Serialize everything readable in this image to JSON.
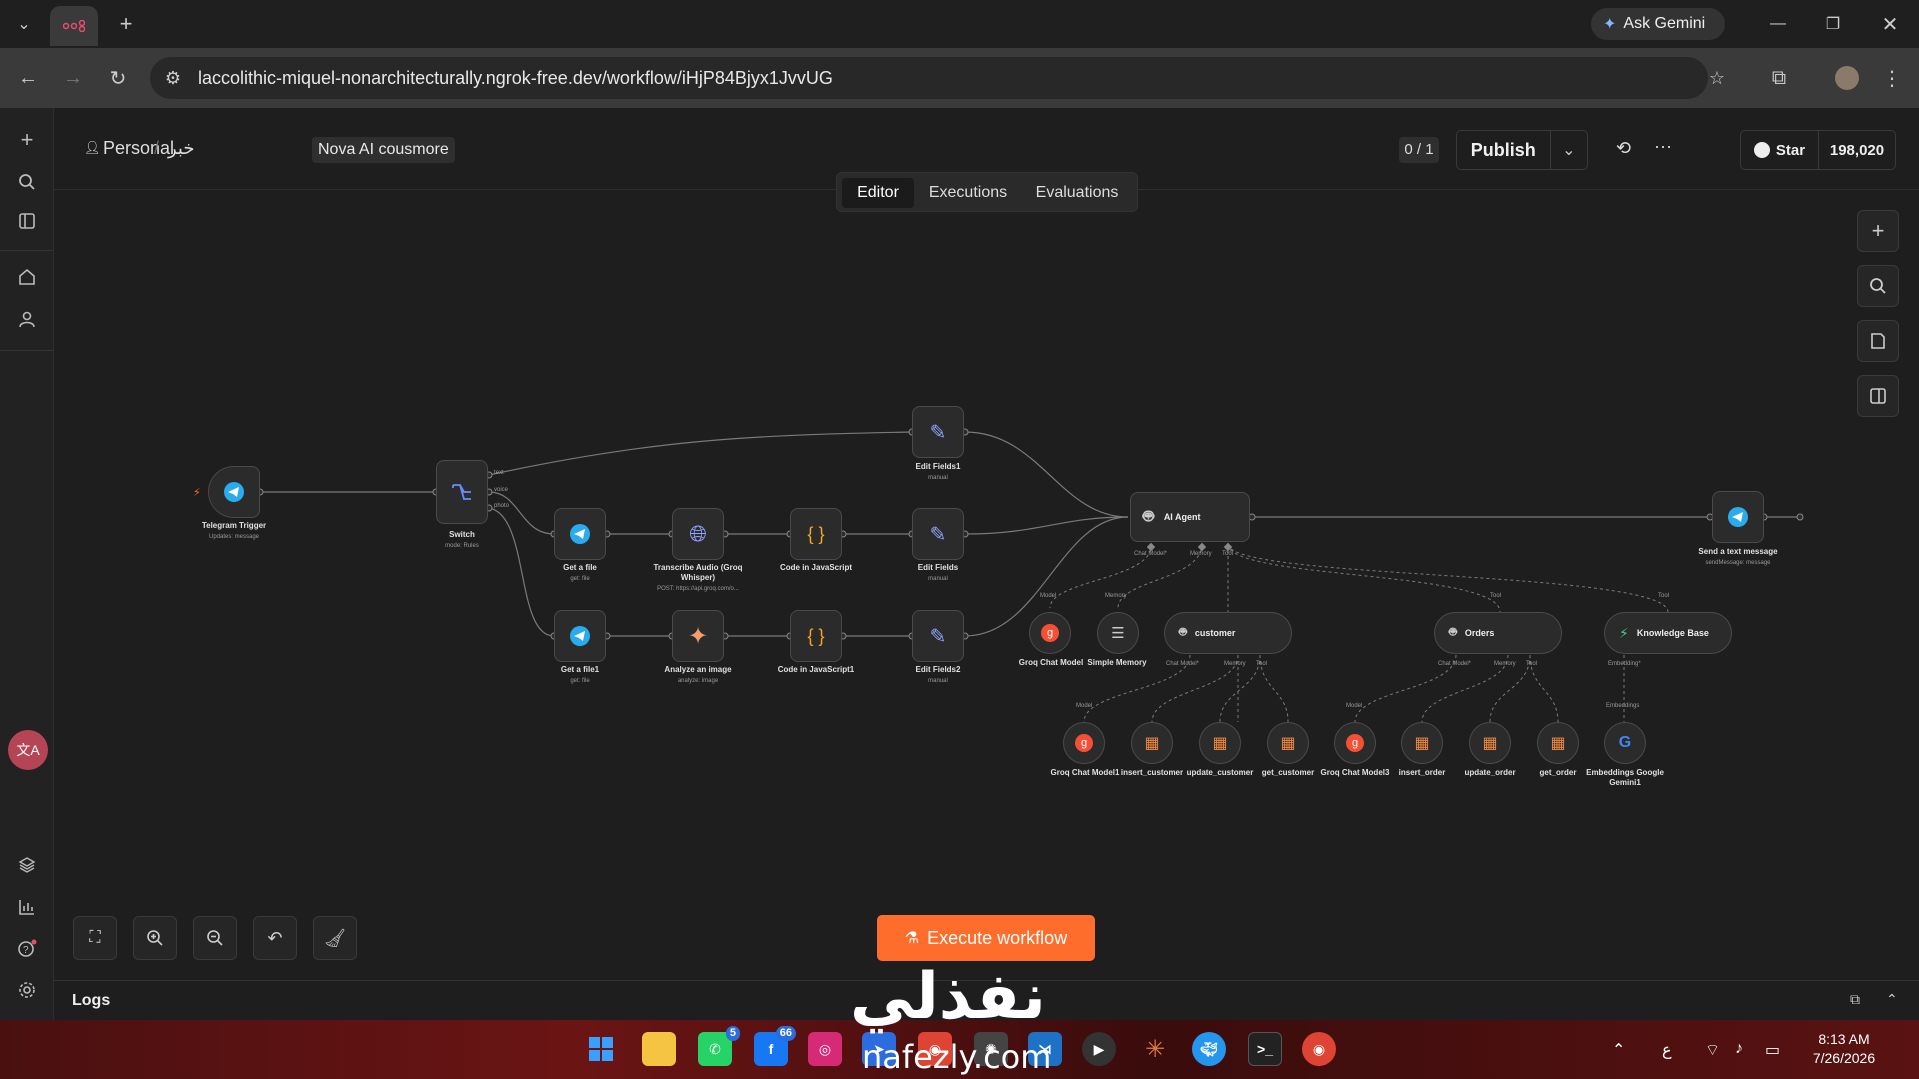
{
  "browser": {
    "url": "laccolithic-miquel-nonarchitecturally.ngrok-free.dev/workflow/iHjP84Bjyx1JvvUG",
    "ask_gemini": "Ask Gemini"
  },
  "header": {
    "project": "Personal",
    "folder": "خبر",
    "workflow_name": "Nova AI cousmore",
    "counter": "0 / 1",
    "publish": "Publish",
    "github_star": "Star",
    "github_count": "198,020"
  },
  "tabs": [
    "Editor",
    "Executions",
    "Evaluations"
  ],
  "nodes": {
    "telegram_trigger": {
      "label": "Telegram Trigger",
      "sub": "Updates: message"
    },
    "switch": {
      "label": "Switch",
      "sub": "mode: Rules",
      "outputs": [
        "text",
        "voice",
        "photo"
      ]
    },
    "edit_fields1": {
      "label": "Edit Fields1",
      "sub": "manual"
    },
    "get_file": {
      "label": "Get a file",
      "sub": "get: file"
    },
    "transcribe": {
      "label": "Transcribe Audio (Groq Whisper)",
      "sub": "POST: https://api.groq.com/o..."
    },
    "code_js": {
      "label": "Code in JavaScript"
    },
    "edit_fields": {
      "label": "Edit Fields",
      "sub": "manual"
    },
    "get_file1": {
      "label": "Get a file1",
      "sub": "get: file"
    },
    "analyze_image": {
      "label": "Analyze an image",
      "sub": "analyze: image"
    },
    "code_js1": {
      "label": "Code in JavaScript1"
    },
    "edit_fields2": {
      "label": "Edit Fields2",
      "sub": "manual"
    },
    "ai_agent": {
      "label": "AI Agent",
      "ports": [
        "Chat Model*",
        "Memory",
        "Tool"
      ]
    },
    "send_message": {
      "label": "Send a text message",
      "sub": "sendMessage: message"
    },
    "groq_model": {
      "label": "Groq Chat Model",
      "port": "Model"
    },
    "simple_memory": {
      "label": "Simple Memory",
      "port": "Memory"
    },
    "customer": {
      "label": "customer",
      "ports": [
        "Chat Model*",
        "Memory",
        "Tool"
      ]
    },
    "orders": {
      "label": "Orders",
      "ports": [
        "Chat Model*",
        "Memory",
        "Tool"
      ]
    },
    "knowledge_base": {
      "label": "Knowledge Base",
      "port": "Embedding*"
    },
    "tool_port_label": "Tool",
    "groq_model1": {
      "label": "Groq Chat Model1",
      "port": "Model"
    },
    "insert_customer": {
      "label": "insert_customer"
    },
    "update_customer": {
      "label": "update_customer"
    },
    "get_customer": {
      "label": "get_customer"
    },
    "groq_model3": {
      "label": "Groq Chat Model3",
      "port": "Model"
    },
    "insert_order": {
      "label": "insert_order"
    },
    "update_order": {
      "label": "update_order"
    },
    "get_order": {
      "label": "get_order"
    },
    "embeddings": {
      "label": "Embeddings Google Gemini1",
      "port": "Embeddings"
    }
  },
  "execute": "Execute workflow",
  "logs": "Logs",
  "taskbar": {
    "whatsapp_badge": "5",
    "app_badge": "66",
    "time": "8:13 AM",
    "date": "7/26/2026",
    "lang": "ع"
  },
  "watermark": {
    "arabic": "نفذلي",
    "latin": "nafezly.com"
  }
}
